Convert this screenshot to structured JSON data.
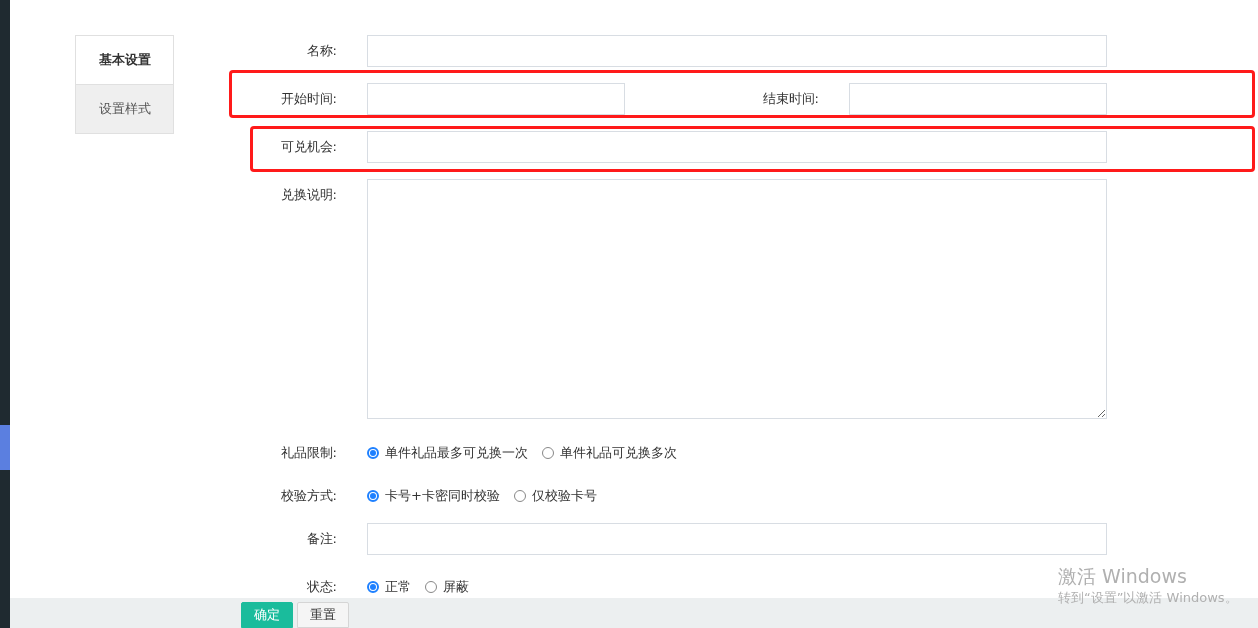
{
  "tabs": [
    {
      "label": "基本设置",
      "selected": true
    },
    {
      "label": "设置样式",
      "selected": false
    }
  ],
  "form": [
    {
      "kind": "input",
      "label": "名称:"
    },
    {
      "kind": "pair",
      "label": "开始时间:",
      "label2": "结束时间:"
    },
    {
      "kind": "input",
      "label": "可兑机会:"
    },
    {
      "kind": "textarea",
      "label": "兑换说明:"
    },
    {
      "kind": "radio",
      "label": "礼品限制:",
      "options": [
        {
          "label": "单件礼品最多可兑换一次",
          "selected": true
        },
        {
          "label": "单件礼品可兑换多次",
          "selected": false
        }
      ]
    },
    {
      "kind": "radio",
      "label": "校验方式:",
      "options": [
        {
          "label": "卡号+卡密同时校验",
          "selected": true
        },
        {
          "label": "仅校验卡号",
          "selected": false
        }
      ]
    },
    {
      "kind": "input",
      "label": "备注:"
    },
    {
      "kind": "radio",
      "label": "状态:",
      "options": [
        {
          "label": "正常",
          "selected": true
        },
        {
          "label": "屏蔽",
          "selected": false
        }
      ]
    }
  ],
  "buttons": [
    {
      "label": "确定",
      "kind": "primary"
    },
    {
      "label": "重置",
      "kind": "default"
    }
  ],
  "activation_notice": {
    "title": "激活 Windows",
    "subtitle": "转到“设置”以激活 Windows。"
  }
}
